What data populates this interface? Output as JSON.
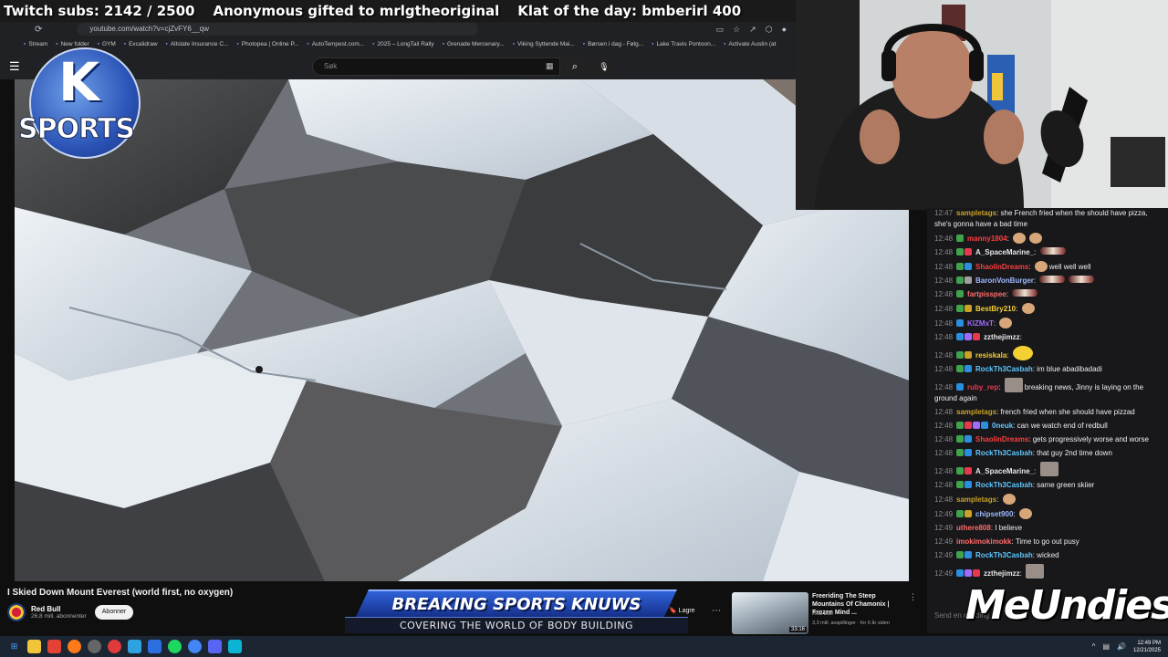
{
  "ticker": {
    "subs": "Twitch subs: 2142 / 2500",
    "gift": "Anonymous gifted to mrlgtheoriginal",
    "klat": "Klat of the day: bmberirl 400"
  },
  "browser": {
    "url": "youtube.com/watch?v=cjZvFY6__qw",
    "bookmarks": [
      "Stream",
      "New folder",
      "GYM",
      "Excalidraw",
      "Allstate Insurance C...",
      "Photopea | Online P...",
      "AutoTempest.com...",
      "2025 – LongTail Rally",
      "Grenade Mercenary...",
      "Viking Syttende Mai...",
      "Børsen i dag - Følg...",
      "Lake Travis Pontoon...",
      "Activate Austin (at"
    ],
    "search_placeholder": "Søk"
  },
  "overlay": {
    "logo_letter": "K",
    "logo_text": "SPORTS",
    "banner_top": "BREAKING SPORTS KNUWS",
    "banner_bottom": "COVERING THE WORLD OF BODY BUILDING",
    "sponsor": "MeUndies"
  },
  "video": {
    "title": "I Skied Down Mount Everest (world first, no oxygen)",
    "channel": "Red Bull",
    "subscribers": "26,8 mill. abonnenter",
    "subscribe_label": "Abonner",
    "save_label": "Lagre"
  },
  "related": {
    "title": "Freeriding The Steep Mountains Of Chamonix | Frozen Mind ...",
    "channel": "Red Bull",
    "meta": "3,3 mill. avspillinger · for 6 år siden",
    "duration": "33:16"
  },
  "chat": {
    "messages": [
      {
        "time": "12:47",
        "user": "sampletags",
        "color": "#c9a227",
        "text": "she French fried when the should have pizza, she's gonna have a bad time",
        "badges": []
      },
      {
        "time": "12:48",
        "user": "manny1804",
        "color": "#ff3d3d",
        "text": "",
        "badges": [
          "#3fa34d"
        ],
        "emotes": [
          "face",
          "face"
        ]
      },
      {
        "time": "12:48",
        "user": "A_SpaceMarine_",
        "color": "#e8e8e8",
        "text": "",
        "badges": [
          "#3fa34d",
          "#e63950"
        ],
        "emotes": [
          "wide"
        ]
      },
      {
        "time": "12:48",
        "user": "ShaolinDreams",
        "color": "#ff3d3d",
        "text": "well well well",
        "badges": [
          "#3fa34d",
          "#2b8fe0"
        ],
        "emotes": [
          "face"
        ]
      },
      {
        "time": "12:48",
        "user": "BaronVonBurger",
        "color": "#9fb8ff",
        "text": "",
        "badges": [
          "#3fa34d",
          "#a0a0a0"
        ],
        "emotes": [
          "wide",
          "wide"
        ]
      },
      {
        "time": "12:48",
        "user": "fartpisspee",
        "color": "#ff6b6b",
        "text": "",
        "badges": [
          "#3fa34d"
        ],
        "emotes": [
          "wide"
        ]
      },
      {
        "time": "12:48",
        "user": "BestBry210",
        "color": "#f5d033",
        "text": "",
        "badges": [
          "#3fa34d",
          "#c9a227"
        ],
        "emotes": [
          "face"
        ]
      },
      {
        "time": "12:48",
        "user": "KIZMxT",
        "color": "#9f6bff",
        "text": "",
        "badges": [
          "#2b8fe0"
        ],
        "emotes": [
          "face"
        ]
      },
      {
        "time": "12:48",
        "user": "zzthejimzz",
        "color": "#e8e8e8",
        "text": "",
        "badges": [
          "#2b8fe0",
          "#9f6bff",
          "#e63950"
        ],
        "emotes": []
      },
      {
        "time": "12:48",
        "user": "resiskala",
        "color": "#f5d033",
        "text": "",
        "badges": [
          "#3fa34d",
          "#c9a227"
        ],
        "emotes": [
          "yellow"
        ]
      },
      {
        "time": "12:48",
        "user": "RockTh3Casbah",
        "color": "#5fc8ff",
        "text": "im blue abadibadadi",
        "badges": [
          "#3fa34d",
          "#2b8fe0"
        ],
        "emotes": []
      },
      {
        "time": "12:48",
        "user": "ruby_rep",
        "color": "#e63950",
        "text": "breaking news, Jinny is laying on the ground again",
        "badges": [
          "#2b8fe0"
        ],
        "emotes": [
          "photo"
        ]
      },
      {
        "time": "12:48",
        "user": "sampletags",
        "color": "#c9a227",
        "text": "french fried when she should have pizzad",
        "badges": [],
        "emotes": []
      },
      {
        "time": "12:48",
        "user": "0neuk",
        "color": "#5fc8ff",
        "text": "can we watch end of redbull",
        "badges": [
          "#3fa34d",
          "#e63950",
          "#9f6bff",
          "#2b8fe0"
        ],
        "emotes": []
      },
      {
        "time": "12:48",
        "user": "ShaolinDreams",
        "color": "#ff3d3d",
        "text": "gets progressively worse and worse",
        "badges": [
          "#3fa34d",
          "#2b8fe0"
        ],
        "emotes": []
      },
      {
        "time": "12:48",
        "user": "RockTh3Casbah",
        "color": "#5fc8ff",
        "text": "that guy 2nd time down",
        "badges": [
          "#3fa34d",
          "#2b8fe0"
        ],
        "emotes": []
      },
      {
        "time": "12:48",
        "user": "A_SpaceMarine_",
        "color": "#e8e8e8",
        "text": "",
        "badges": [
          "#3fa34d",
          "#e63950"
        ],
        "emotes": [
          "photo"
        ]
      },
      {
        "time": "12:48",
        "user": "RockTh3Casbah",
        "color": "#5fc8ff",
        "text": "same green skiier",
        "badges": [
          "#3fa34d",
          "#2b8fe0"
        ],
        "emotes": []
      },
      {
        "time": "12:48",
        "user": "sampletags",
        "color": "#c9a227",
        "text": "",
        "badges": [],
        "emotes": [
          "face"
        ]
      },
      {
        "time": "12:49",
        "user": "chipset900",
        "color": "#9fb8ff",
        "text": "",
        "badges": [
          "#3fa34d",
          "#c9a227"
        ],
        "emotes": [
          "face"
        ]
      },
      {
        "time": "12:49",
        "user": "uthere808",
        "color": "#ff6b6b",
        "text": "I believe",
        "badges": [],
        "emotes": []
      },
      {
        "time": "12:49",
        "user": "imokimokimokk",
        "color": "#ff6b6b",
        "text": "Time to go out pusy",
        "badges": [],
        "emotes": []
      },
      {
        "time": "12:49",
        "user": "RockTh3Casbah",
        "color": "#5fc8ff",
        "text": "wicked",
        "badges": [
          "#3fa34d",
          "#2b8fe0"
        ],
        "emotes": []
      },
      {
        "time": "12:49",
        "user": "zzthejimzz",
        "color": "#e8e8e8",
        "text": "",
        "badges": [
          "#2b8fe0",
          "#9f6bff",
          "#e63950"
        ],
        "emotes": [
          "photo"
        ]
      }
    ]
  },
  "taskbar": {
    "time": "12:49 PM",
    "date": "12/21/2025"
  }
}
